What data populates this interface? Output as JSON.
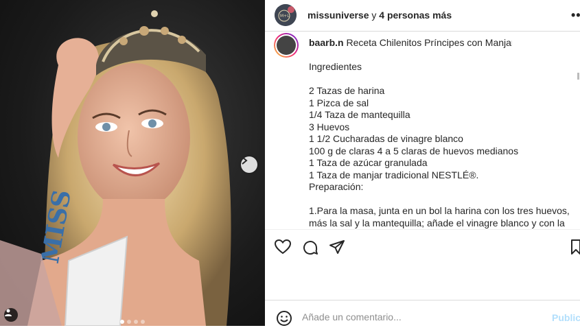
{
  "header": {
    "username": "missuniverse",
    "joiner": " y ",
    "others": "4 personas más",
    "more_icon": "more-horizontal-icon"
  },
  "header_avatar": {
    "badge_text": "M+L"
  },
  "caption": {
    "username": "baarb.n",
    "first_line": "Receta Chilenitos Príncipes con Manjar c",
    "heading": "Ingredientes",
    "ingredients": [
      "2 Tazas de harina",
      "1 Pizca de sal",
      "1/4 Taza de mantequilla",
      "3 Huevos",
      "1 1/2 Cucharadas de vinagre blanco",
      "100 g de claras 4 a 5 claras de huevos medianos",
      "1 Taza de azúcar granulada",
      "1 Taza de manjar tradicional NESTLÉ®."
    ],
    "prep_heading": "Preparación:",
    "prep_lines": [
      "1.Para la masa, junta en un bol la harina con los tres huevos,",
      "más la sal y la mantequilla; añade el vinagre blanco y con la"
    ]
  },
  "photo": {
    "sash_text": "MISS",
    "carousel_dots": 4,
    "active_dot": 1,
    "next_icon": "chevron-right-icon",
    "tag_icon": "person-tag-icon"
  },
  "actions": {
    "icons": [
      "heart-icon",
      "comment-icon",
      "share-icon",
      "bookmark-icon"
    ]
  },
  "add_comment": {
    "placeholder": "Añade un comentario...",
    "publish_label": "Publica",
    "emoji_icon": "emoji-icon"
  },
  "colors": {
    "text": "#262626",
    "muted": "#8e8e8e",
    "publish_disabled": "#b2dffc",
    "border": "#dbdbdb"
  }
}
